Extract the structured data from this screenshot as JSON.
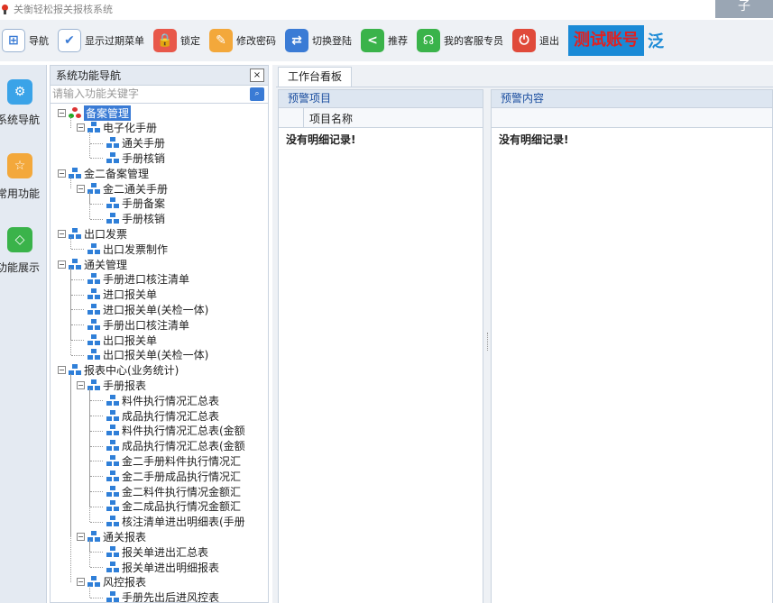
{
  "window": {
    "title": "关衡轻松报关报核系统",
    "corner_glyph": "子"
  },
  "toolbar": {
    "items": [
      {
        "label": "导航",
        "icon": "nav-tree-icon",
        "color": "#ffffff",
        "glyph": "⊞"
      },
      {
        "label": "显示过期菜单",
        "icon": "checklist-icon",
        "color": "#ffffff",
        "glyph": "✔"
      },
      {
        "label": "锁定",
        "icon": "lock-icon",
        "color": "#e8584a",
        "glyph": "🔒"
      },
      {
        "label": "修改密码",
        "icon": "edit-icon",
        "color": "#f3a83b",
        "glyph": "✎"
      },
      {
        "label": "切换登陆",
        "icon": "switch-user-icon",
        "color": "#3a7bd5",
        "glyph": "⇄"
      },
      {
        "label": "推荐",
        "icon": "share-icon",
        "color": "#3ab34a",
        "glyph": "<"
      },
      {
        "label": "我的客服专员",
        "icon": "support-icon",
        "color": "#3ab34a",
        "glyph": "☊"
      },
      {
        "label": "退出",
        "icon": "power-icon",
        "color": "#e04a3a",
        "glyph": "⏻"
      }
    ],
    "test_account": "测试账号",
    "cut_glyph": "泛"
  },
  "left_nav": {
    "items": [
      {
        "label": "系统导航",
        "icon": "gear-icon",
        "color": "#3aa3e8",
        "glyph": "⚙"
      },
      {
        "label": "常用功能",
        "icon": "star-folder-icon",
        "color": "#f3a83b",
        "glyph": "☆"
      },
      {
        "label": "功能展示",
        "icon": "cube-icon",
        "color": "#3ab34a",
        "glyph": "◇"
      }
    ]
  },
  "tree_panel": {
    "title": "系统功能导航",
    "close": "×",
    "search_placeholder": "请输入功能关键字",
    "nodes": [
      {
        "label": "备案管理",
        "level": 0,
        "toggle": "−",
        "icon": "fruit",
        "selected": true
      },
      {
        "label": "电子化手册",
        "level": 1,
        "toggle": "−",
        "icon": "org"
      },
      {
        "label": "通关手册",
        "level": 2,
        "toggle": "",
        "icon": "org"
      },
      {
        "label": "手册核销",
        "level": 2,
        "toggle": "",
        "icon": "org"
      },
      {
        "label": "金二备案管理",
        "level": 0,
        "toggle": "−",
        "icon": "org"
      },
      {
        "label": "金二通关手册",
        "level": 1,
        "toggle": "−",
        "icon": "org"
      },
      {
        "label": "手册备案",
        "level": 2,
        "toggle": "",
        "icon": "org"
      },
      {
        "label": "手册核销",
        "level": 2,
        "toggle": "",
        "icon": "org"
      },
      {
        "label": "出口发票",
        "level": 0,
        "toggle": "−",
        "icon": "org"
      },
      {
        "label": "出口发票制作",
        "level": 1,
        "toggle": "",
        "icon": "org"
      },
      {
        "label": "通关管理",
        "level": 0,
        "toggle": "−",
        "icon": "org"
      },
      {
        "label": "手册进口核注清单",
        "level": 1,
        "toggle": "",
        "icon": "org"
      },
      {
        "label": "进口报关单",
        "level": 1,
        "toggle": "",
        "icon": "org"
      },
      {
        "label": "进口报关单(关检一体)",
        "level": 1,
        "toggle": "",
        "icon": "org"
      },
      {
        "label": "手册出口核注清单",
        "level": 1,
        "toggle": "",
        "icon": "org"
      },
      {
        "label": "出口报关单",
        "level": 1,
        "toggle": "",
        "icon": "org"
      },
      {
        "label": "出口报关单(关检一体)",
        "level": 1,
        "toggle": "",
        "icon": "org"
      },
      {
        "label": "报表中心(业务统计)",
        "level": 0,
        "toggle": "−",
        "icon": "org"
      },
      {
        "label": "手册报表",
        "level": 1,
        "toggle": "−",
        "icon": "org"
      },
      {
        "label": "料件执行情况汇总表",
        "level": 2,
        "toggle": "",
        "icon": "org"
      },
      {
        "label": "成品执行情况汇总表",
        "level": 2,
        "toggle": "",
        "icon": "org"
      },
      {
        "label": "料件执行情况汇总表(金额",
        "level": 2,
        "toggle": "",
        "icon": "org"
      },
      {
        "label": "成品执行情况汇总表(金额",
        "level": 2,
        "toggle": "",
        "icon": "org"
      },
      {
        "label": "金二手册料件执行情况汇",
        "level": 2,
        "toggle": "",
        "icon": "org"
      },
      {
        "label": "金二手册成品执行情况汇",
        "level": 2,
        "toggle": "",
        "icon": "org"
      },
      {
        "label": "金二料件执行情况金额汇",
        "level": 2,
        "toggle": "",
        "icon": "org"
      },
      {
        "label": "金二成品执行情况金额汇",
        "level": 2,
        "toggle": "",
        "icon": "org"
      },
      {
        "label": "核注清单进出明细表(手册",
        "level": 2,
        "toggle": "",
        "icon": "org"
      },
      {
        "label": "通关报表",
        "level": 1,
        "toggle": "−",
        "icon": "org"
      },
      {
        "label": "报关单进出汇总表",
        "level": 2,
        "toggle": "",
        "icon": "org"
      },
      {
        "label": "报关单进出明细报表",
        "level": 2,
        "toggle": "",
        "icon": "org"
      },
      {
        "label": "风控报表",
        "level": 1,
        "toggle": "−",
        "icon": "org"
      },
      {
        "label": "手册先出后进风控表",
        "level": 2,
        "toggle": "",
        "icon": "org"
      }
    ]
  },
  "workspace": {
    "tab_label": "工作台看板",
    "left_panel": {
      "title": "预警项目",
      "column": "项目名称",
      "empty": "没有明细记录!"
    },
    "right_panel": {
      "title": "预警内容",
      "empty": "没有明细记录!"
    }
  }
}
